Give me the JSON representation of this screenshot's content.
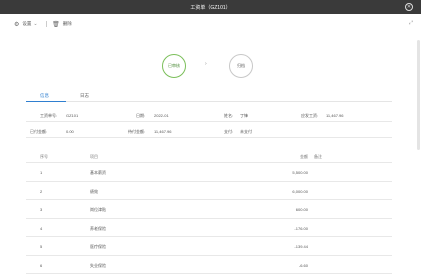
{
  "window": {
    "title": "工资单（GZ101）",
    "close": "✕"
  },
  "toolbar": {
    "settings_label": "设置",
    "delete_label": "删除"
  },
  "flow": {
    "step1": "已审核",
    "arrow": "›",
    "step2": "归档"
  },
  "tabs": [
    {
      "label": "信息"
    },
    {
      "label": "日志"
    }
  ],
  "info": {
    "row1": [
      {
        "label": "工资单号:",
        "value": "GZ101"
      },
      {
        "label": "日期:",
        "value": "2022-01"
      },
      {
        "label": "姓名:",
        "value": "丁锋"
      },
      {
        "label": "应发工资:",
        "value": "11,467.96"
      }
    ],
    "row2": [
      {
        "label": "已付金额:",
        "value": "0.00"
      },
      {
        "label": "待付金额:",
        "value": "11,467.96"
      },
      {
        "label": "支付:",
        "value": "未支付"
      }
    ]
  },
  "table": {
    "headers": {
      "no": "序号",
      "item": "项目",
      "amount": "金额",
      "note": "备注"
    },
    "rows": [
      {
        "no": "1",
        "item": "基本薪资",
        "amount": "5,500.00"
      },
      {
        "no": "2",
        "item": "绩效",
        "amount": "6,000.00"
      },
      {
        "no": "3",
        "item": "岗位津贴",
        "amount": "600.00"
      },
      {
        "no": "4",
        "item": "养老保险",
        "amount": "-176.00"
      },
      {
        "no": "5",
        "item": "医疗保险",
        "amount": "-139.44"
      },
      {
        "no": "6",
        "item": "失业保险",
        "amount": "-6.60"
      }
    ]
  }
}
